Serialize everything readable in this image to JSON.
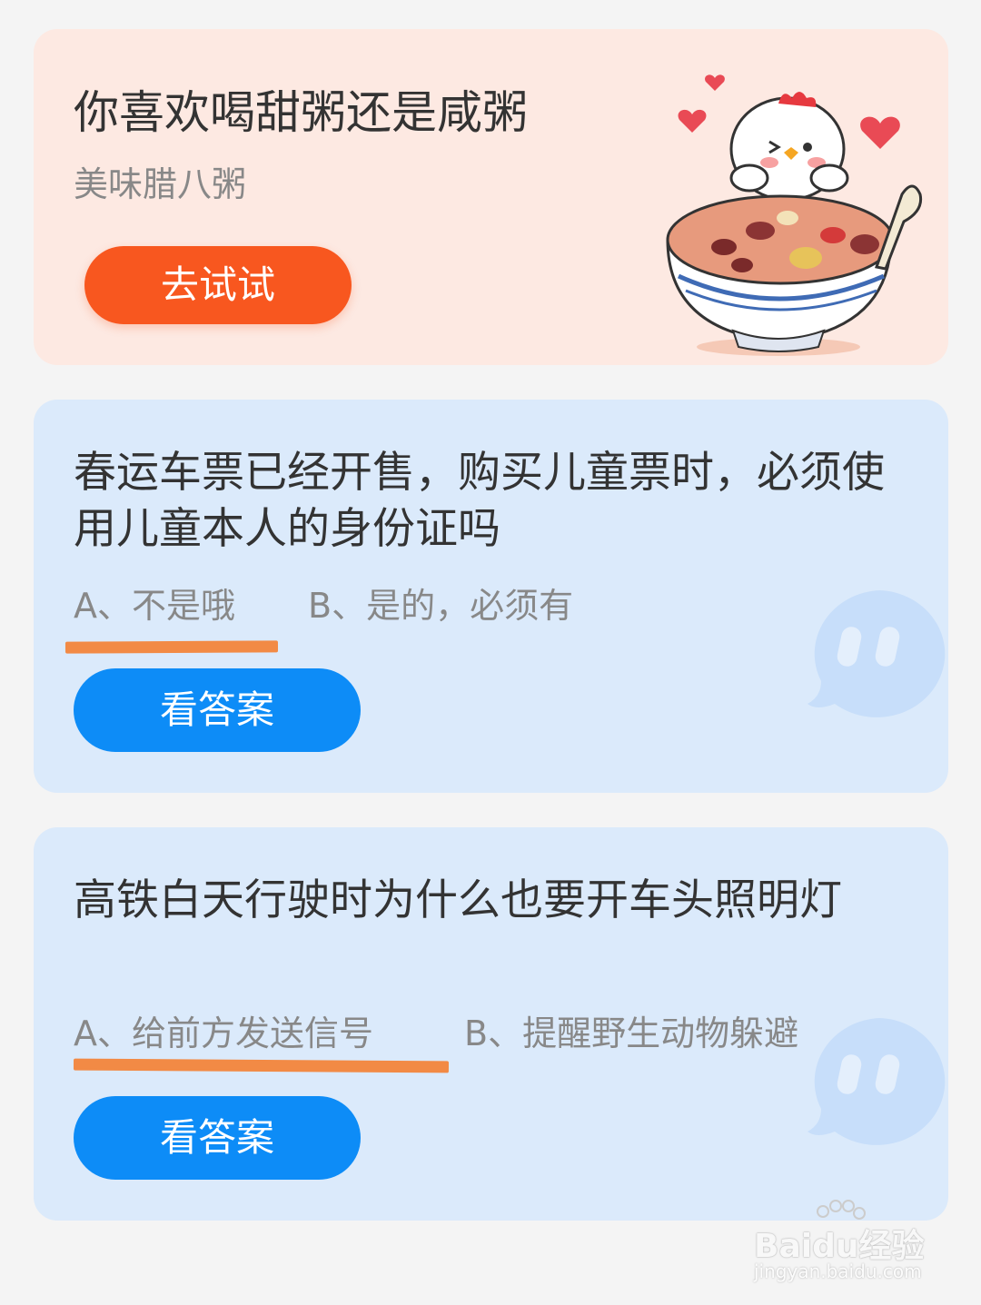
{
  "promo": {
    "title": "你喜欢喝甜粥还是咸粥",
    "subtitle": "美味腊八粥",
    "button_label": "去试试",
    "illustration_icon": "chicken-porridge-bowl-icon"
  },
  "quizzes": [
    {
      "question": "春运车票已经开售，购买儿童票时，必须使用儿童本人的身份证吗",
      "option_a": "A、不是哦",
      "option_b": "B、是的，必须有",
      "button_label": "看答案",
      "underlined_option": "A"
    },
    {
      "question": "高铁白天行驶时为什么也要开车头照明灯",
      "option_a": "A、给前方发送信号",
      "option_b": "B、提醒野生动物躲避",
      "button_label": "看答案",
      "underlined_option": "A"
    }
  ],
  "watermark": {
    "brand": "Baidu经验",
    "url": "jingyan.baidu.com"
  },
  "colors": {
    "promo_bg": "#fde9e2",
    "quiz_bg": "#dbeafb",
    "promo_button": "#f8571f",
    "answer_button": "#0d8cf7",
    "underline": "#f28a45"
  }
}
